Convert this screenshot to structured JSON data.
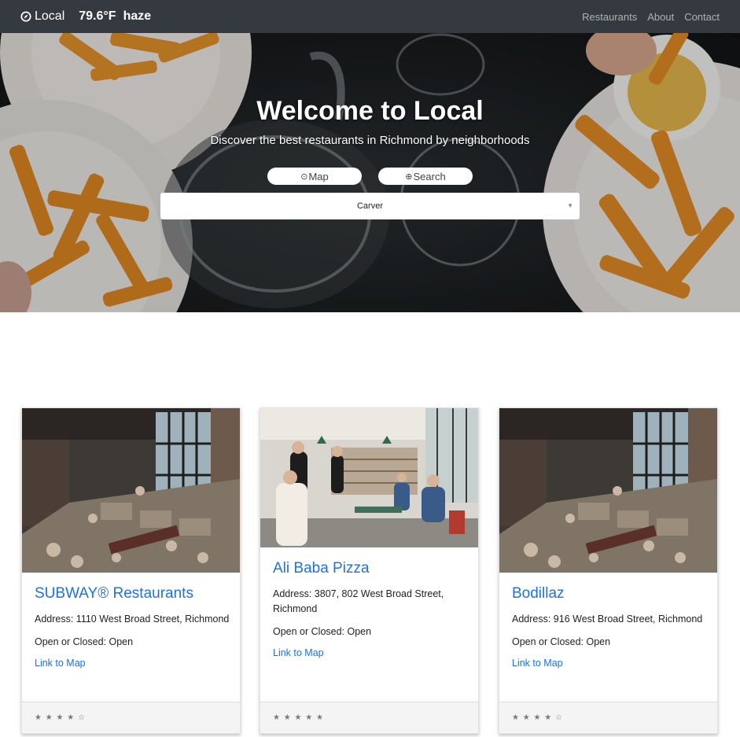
{
  "navbar": {
    "brand_name": "Local",
    "temperature": "79.6°F",
    "condition": "haze",
    "links": [
      "Restaurants",
      "About",
      "Contact"
    ]
  },
  "hero": {
    "title": "Welcome to Local",
    "subtitle": "Discover the best restaurants in Richmond by neighborhoods",
    "map_button": "Map",
    "search_button": "Search",
    "neighborhood_select": "Carver"
  },
  "restaurants": [
    {
      "name": "SUBWAY® Restaurants",
      "address": "Address: 1110 West Broad Street, Richmond",
      "status": "Open or Closed: Open",
      "map_link": "Link to Map",
      "rating_text": "★ ★ ★ ★ ☆"
    },
    {
      "name": "Ali Baba Pizza",
      "address": "Address: 3807, 802 West Broad Street, Richmond",
      "status": "Open or Closed: Open",
      "map_link": "Link to Map",
      "rating_text": "★ ★ ★ ★ ★"
    },
    {
      "name": "Bodillaz",
      "address": "Address: 916 West Broad Street, Richmond",
      "status": "Open or Closed: Open",
      "map_link": "Link to Map",
      "rating_text": "★ ★ ★ ★ ☆"
    }
  ],
  "colors": {
    "navbar_bg": "#343a40",
    "link_blue": "#1a73e8"
  }
}
